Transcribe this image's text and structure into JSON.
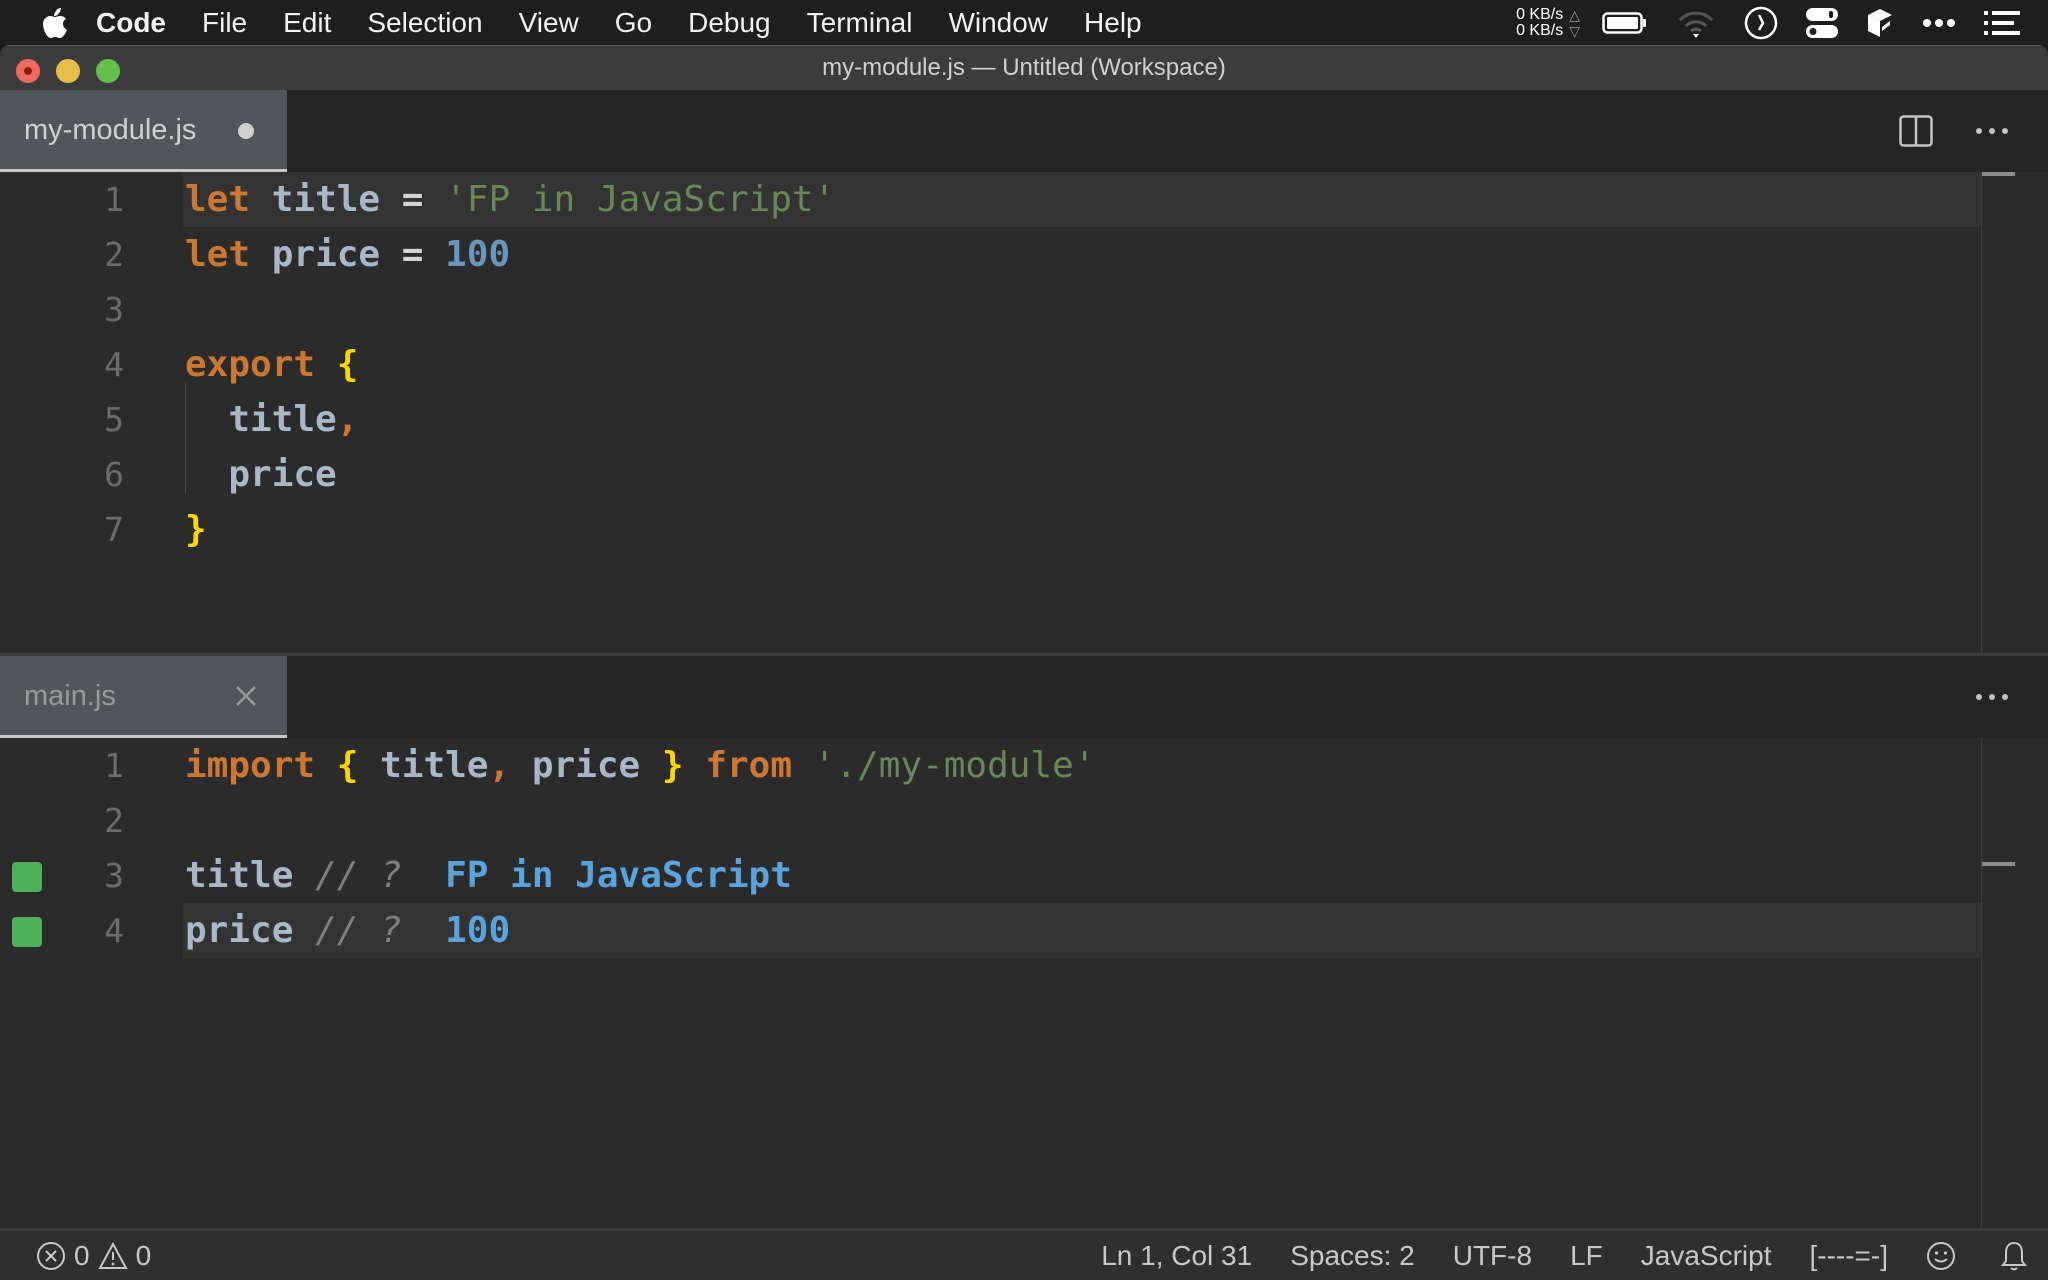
{
  "menubar": {
    "app": "Code",
    "items": [
      "File",
      "Edit",
      "Selection",
      "View",
      "Go",
      "Debug",
      "Terminal",
      "Window",
      "Help"
    ],
    "network": {
      "up": "0 KB/s",
      "down": "0 KB/s"
    },
    "tray_icons": [
      "battery-icon",
      "wifi-icon",
      "clock-icon",
      "control-center-icon",
      "app-cube-icon",
      "more-icon",
      "list-icon"
    ]
  },
  "window": {
    "title": "my-module.js — Untitled (Workspace)"
  },
  "top_group": {
    "tab": {
      "label": "my-module.js",
      "modified": true
    },
    "actions": [
      "split-editor-icon",
      "more-actions-icon"
    ],
    "lines": [
      {
        "n": "1",
        "tokens": [
          [
            "kw",
            "let"
          ],
          [
            "op",
            " "
          ],
          [
            "id",
            "title"
          ],
          [
            "op",
            " = "
          ],
          [
            "str",
            "'FP in JavaScript'"
          ]
        ]
      },
      {
        "n": "2",
        "tokens": [
          [
            "kw",
            "let"
          ],
          [
            "op",
            " "
          ],
          [
            "id",
            "price"
          ],
          [
            "op",
            " = "
          ],
          [
            "num",
            "100"
          ]
        ]
      },
      {
        "n": "3",
        "tokens": []
      },
      {
        "n": "4",
        "tokens": [
          [
            "kw",
            "export"
          ],
          [
            "op",
            " "
          ],
          [
            "br",
            "{"
          ]
        ]
      },
      {
        "n": "5",
        "tokens": [
          [
            "op",
            "  "
          ],
          [
            "id",
            "title"
          ],
          [
            "comma",
            ","
          ]
        ]
      },
      {
        "n": "6",
        "tokens": [
          [
            "op",
            "  "
          ],
          [
            "id",
            "price"
          ]
        ]
      },
      {
        "n": "7",
        "tokens": [
          [
            "br",
            "}"
          ]
        ]
      }
    ]
  },
  "bottom_group": {
    "tab": {
      "label": "main.js",
      "modified": false
    },
    "actions": [
      "more-actions-icon"
    ],
    "lines": [
      {
        "n": "1",
        "tokens": [
          [
            "kw",
            "import"
          ],
          [
            "op",
            " "
          ],
          [
            "br",
            "{"
          ],
          [
            "op",
            " "
          ],
          [
            "id",
            "title"
          ],
          [
            "comma",
            ","
          ],
          [
            "op",
            " "
          ],
          [
            "id",
            "price"
          ],
          [
            "op",
            " "
          ],
          [
            "br",
            "}"
          ],
          [
            "op",
            " "
          ],
          [
            "kw",
            "from"
          ],
          [
            "op",
            " "
          ],
          [
            "str",
            "'./my-module'"
          ]
        ]
      },
      {
        "n": "2",
        "tokens": []
      },
      {
        "n": "3",
        "mark": true,
        "tokens": [
          [
            "id",
            "title"
          ],
          [
            "op",
            " "
          ],
          [
            "cm",
            "// ?"
          ],
          [
            "op",
            "  "
          ],
          [
            "res",
            "FP in JavaScript"
          ]
        ]
      },
      {
        "n": "4",
        "mark": true,
        "tokens": [
          [
            "id",
            "price"
          ],
          [
            "op",
            " "
          ],
          [
            "cm",
            "// ?"
          ],
          [
            "op",
            "  "
          ],
          [
            "res",
            "100"
          ]
        ]
      }
    ]
  },
  "statusbar": {
    "errors": "0",
    "warnings": "0",
    "position": "Ln 1, Col 31",
    "indent": "Spaces: 2",
    "encoding": "UTF-8",
    "eol": "LF",
    "language": "JavaScript",
    "extension": "[----=-]"
  },
  "colors": {
    "keyword": "#cc7832",
    "identifier": "#a9b7c6",
    "string": "#6a8759",
    "number": "#6897bb",
    "bracket": "#ffd700",
    "result": "#5ba3dc",
    "coverage_mark": "#4fb05a"
  }
}
